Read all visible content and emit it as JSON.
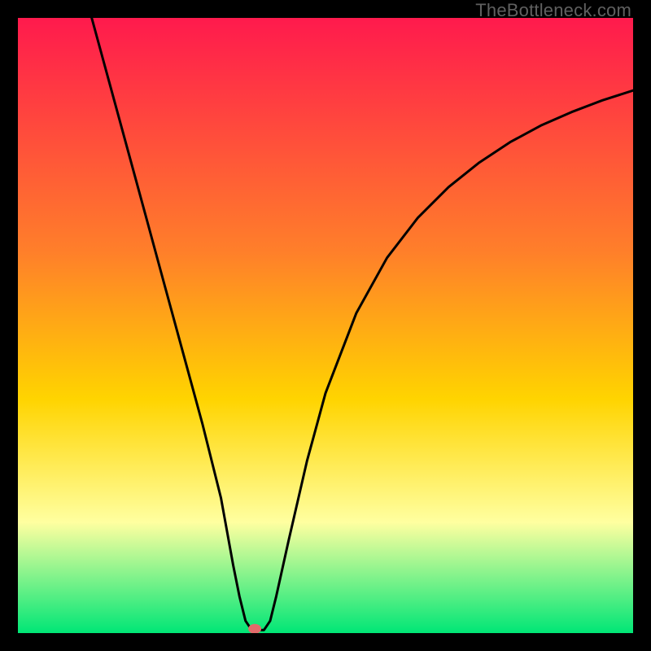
{
  "watermark": "TheBottleneck.com",
  "chart_data": {
    "type": "line",
    "title": "",
    "xlabel": "",
    "ylabel": "",
    "xlim": [
      0,
      100
    ],
    "ylim": [
      0,
      100
    ],
    "background_gradient": {
      "top": "#ff1a4d",
      "mid_upper": "#ff7f2a",
      "mid": "#ffd400",
      "mid_lower": "#ffffa0",
      "bottom": "#00e676"
    },
    "series": [
      {
        "name": "curve",
        "x": [
          12,
          15,
          18,
          21,
          24,
          27,
          30,
          33,
          35,
          36,
          37,
          38,
          39,
          40,
          41,
          42,
          44,
          47,
          50,
          55,
          60,
          65,
          70,
          75,
          80,
          85,
          90,
          95,
          100
        ],
        "y": [
          100,
          89,
          78,
          67,
          56,
          45,
          34,
          22,
          11,
          6,
          2,
          0.5,
          0.5,
          0.5,
          2,
          6,
          15,
          28,
          39,
          52,
          61,
          67.5,
          72.5,
          76.5,
          79.8,
          82.5,
          84.7,
          86.6,
          88.2
        ]
      }
    ],
    "marker": {
      "x": 38.5,
      "y": 0.7,
      "color": "#e26a6a"
    }
  }
}
